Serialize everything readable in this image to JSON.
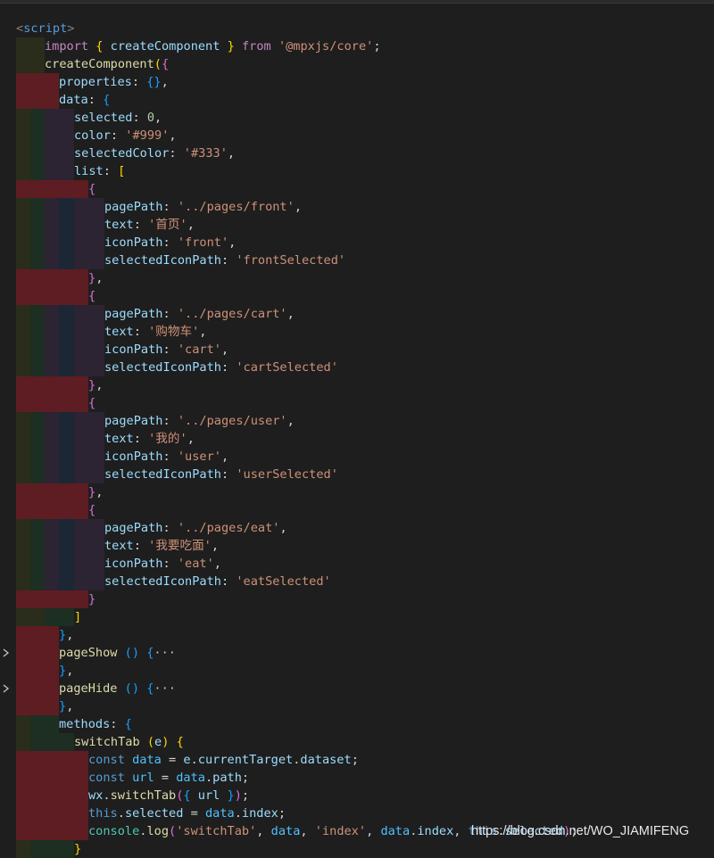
{
  "colors": {
    "background": "#1e1e1e",
    "guide_yellow": "#2a2d1b",
    "guide_green": "#1c2f22",
    "guide_purple": "#2c2333",
    "guide_blue": "#1c2736",
    "guide_error": "#5e1d22"
  },
  "code_lines": [
    {
      "tokens": [
        {
          "t": "<",
          "c": "#808080"
        },
        {
          "t": "script",
          "c": "#569cd6"
        },
        {
          "t": ">",
          "c": "#808080"
        }
      ]
    },
    {
      "tokens": [
        {
          "t": "import",
          "c": "#c586c0"
        },
        {
          "t": " ",
          "c": "#d4d4d4"
        },
        {
          "t": "{",
          "c": "#ffd700"
        },
        {
          "t": " createComponent ",
          "c": "#9cdcfe"
        },
        {
          "t": "}",
          "c": "#ffd700"
        },
        {
          "t": " ",
          "c": "#d4d4d4"
        },
        {
          "t": "from",
          "c": "#c586c0"
        },
        {
          "t": " ",
          "c": "#d4d4d4"
        },
        {
          "t": "'@mpxjs/core'",
          "c": "#ce9178"
        },
        {
          "t": ";",
          "c": "#d4d4d4"
        }
      ]
    },
    {
      "tokens": [
        {
          "t": "createComponent",
          "c": "#dcdcaa"
        },
        {
          "t": "(",
          "c": "#ffd700"
        },
        {
          "t": "{",
          "c": "#da70d6"
        }
      ]
    },
    {
      "tokens": [
        {
          "t": "properties",
          "c": "#9cdcfe"
        },
        {
          "t": ": ",
          "c": "#d4d4d4"
        },
        {
          "t": "{}",
          "c": "#179fff"
        },
        {
          "t": ",",
          "c": "#d4d4d4"
        }
      ]
    },
    {
      "tokens": [
        {
          "t": "data",
          "c": "#9cdcfe"
        },
        {
          "t": ": ",
          "c": "#d4d4d4"
        },
        {
          "t": "{",
          "c": "#179fff"
        }
      ]
    },
    {
      "tokens": [
        {
          "t": "selected",
          "c": "#9cdcfe"
        },
        {
          "t": ": ",
          "c": "#d4d4d4"
        },
        {
          "t": "0",
          "c": "#b5cea8"
        },
        {
          "t": ",",
          "c": "#d4d4d4"
        }
      ]
    },
    {
      "tokens": [
        {
          "t": "color",
          "c": "#9cdcfe"
        },
        {
          "t": ": ",
          "c": "#d4d4d4"
        },
        {
          "t": "'#999'",
          "c": "#ce9178"
        },
        {
          "t": ",",
          "c": "#d4d4d4"
        }
      ]
    },
    {
      "tokens": [
        {
          "t": "selectedColor",
          "c": "#9cdcfe"
        },
        {
          "t": ": ",
          "c": "#d4d4d4"
        },
        {
          "t": "'#333'",
          "c": "#ce9178"
        },
        {
          "t": ",",
          "c": "#d4d4d4"
        }
      ]
    },
    {
      "tokens": [
        {
          "t": "list",
          "c": "#9cdcfe"
        },
        {
          "t": ": ",
          "c": "#d4d4d4"
        },
        {
          "t": "[",
          "c": "#ffd700"
        }
      ]
    },
    {
      "tokens": [
        {
          "t": "{",
          "c": "#da70d6"
        }
      ]
    },
    {
      "tokens": [
        {
          "t": "pagePath",
          "c": "#9cdcfe"
        },
        {
          "t": ": ",
          "c": "#d4d4d4"
        },
        {
          "t": "'../pages/front'",
          "c": "#ce9178"
        },
        {
          "t": ",",
          "c": "#d4d4d4"
        }
      ]
    },
    {
      "tokens": [
        {
          "t": "text",
          "c": "#9cdcfe"
        },
        {
          "t": ": ",
          "c": "#d4d4d4"
        },
        {
          "t": "'首页'",
          "c": "#ce9178"
        },
        {
          "t": ",",
          "c": "#d4d4d4"
        }
      ]
    },
    {
      "tokens": [
        {
          "t": "iconPath",
          "c": "#9cdcfe"
        },
        {
          "t": ": ",
          "c": "#d4d4d4"
        },
        {
          "t": "'front'",
          "c": "#ce9178"
        },
        {
          "t": ",",
          "c": "#d4d4d4"
        }
      ]
    },
    {
      "tokens": [
        {
          "t": "selectedIconPath",
          "c": "#9cdcfe"
        },
        {
          "t": ": ",
          "c": "#d4d4d4"
        },
        {
          "t": "'frontSelected'",
          "c": "#ce9178"
        }
      ]
    },
    {
      "tokens": [
        {
          "t": "}",
          "c": "#da70d6"
        },
        {
          "t": ",",
          "c": "#d4d4d4"
        }
      ]
    },
    {
      "tokens": [
        {
          "t": "{",
          "c": "#da70d6"
        }
      ]
    },
    {
      "tokens": [
        {
          "t": "pagePath",
          "c": "#9cdcfe"
        },
        {
          "t": ": ",
          "c": "#d4d4d4"
        },
        {
          "t": "'../pages/cart'",
          "c": "#ce9178"
        },
        {
          "t": ",",
          "c": "#d4d4d4"
        }
      ]
    },
    {
      "tokens": [
        {
          "t": "text",
          "c": "#9cdcfe"
        },
        {
          "t": ": ",
          "c": "#d4d4d4"
        },
        {
          "t": "'购物车'",
          "c": "#ce9178"
        },
        {
          "t": ",",
          "c": "#d4d4d4"
        }
      ]
    },
    {
      "tokens": [
        {
          "t": "iconPath",
          "c": "#9cdcfe"
        },
        {
          "t": ": ",
          "c": "#d4d4d4"
        },
        {
          "t": "'cart'",
          "c": "#ce9178"
        },
        {
          "t": ",",
          "c": "#d4d4d4"
        }
      ]
    },
    {
      "tokens": [
        {
          "t": "selectedIconPath",
          "c": "#9cdcfe"
        },
        {
          "t": ": ",
          "c": "#d4d4d4"
        },
        {
          "t": "'cartSelected'",
          "c": "#ce9178"
        }
      ]
    },
    {
      "tokens": [
        {
          "t": "}",
          "c": "#da70d6"
        },
        {
          "t": ",",
          "c": "#d4d4d4"
        }
      ]
    },
    {
      "tokens": [
        {
          "t": "{",
          "c": "#da70d6"
        }
      ]
    },
    {
      "tokens": [
        {
          "t": "pagePath",
          "c": "#9cdcfe"
        },
        {
          "t": ": ",
          "c": "#d4d4d4"
        },
        {
          "t": "'../pages/user'",
          "c": "#ce9178"
        },
        {
          "t": ",",
          "c": "#d4d4d4"
        }
      ]
    },
    {
      "tokens": [
        {
          "t": "text",
          "c": "#9cdcfe"
        },
        {
          "t": ": ",
          "c": "#d4d4d4"
        },
        {
          "t": "'我的'",
          "c": "#ce9178"
        },
        {
          "t": ",",
          "c": "#d4d4d4"
        }
      ]
    },
    {
      "tokens": [
        {
          "t": "iconPath",
          "c": "#9cdcfe"
        },
        {
          "t": ": ",
          "c": "#d4d4d4"
        },
        {
          "t": "'user'",
          "c": "#ce9178"
        },
        {
          "t": ",",
          "c": "#d4d4d4"
        }
      ]
    },
    {
      "tokens": [
        {
          "t": "selectedIconPath",
          "c": "#9cdcfe"
        },
        {
          "t": ": ",
          "c": "#d4d4d4"
        },
        {
          "t": "'userSelected'",
          "c": "#ce9178"
        }
      ]
    },
    {
      "tokens": [
        {
          "t": "}",
          "c": "#da70d6"
        },
        {
          "t": ",",
          "c": "#d4d4d4"
        }
      ]
    },
    {
      "tokens": [
        {
          "t": "{",
          "c": "#da70d6"
        }
      ]
    },
    {
      "tokens": [
        {
          "t": "pagePath",
          "c": "#9cdcfe"
        },
        {
          "t": ": ",
          "c": "#d4d4d4"
        },
        {
          "t": "'../pages/eat'",
          "c": "#ce9178"
        },
        {
          "t": ",",
          "c": "#d4d4d4"
        }
      ]
    },
    {
      "tokens": [
        {
          "t": "text",
          "c": "#9cdcfe"
        },
        {
          "t": ": ",
          "c": "#d4d4d4"
        },
        {
          "t": "'我要吃面'",
          "c": "#ce9178"
        },
        {
          "t": ",",
          "c": "#d4d4d4"
        }
      ]
    },
    {
      "tokens": [
        {
          "t": "iconPath",
          "c": "#9cdcfe"
        },
        {
          "t": ": ",
          "c": "#d4d4d4"
        },
        {
          "t": "'eat'",
          "c": "#ce9178"
        },
        {
          "t": ",",
          "c": "#d4d4d4"
        }
      ]
    },
    {
      "tokens": [
        {
          "t": "selectedIconPath",
          "c": "#9cdcfe"
        },
        {
          "t": ": ",
          "c": "#d4d4d4"
        },
        {
          "t": "'eatSelected'",
          "c": "#ce9178"
        }
      ]
    },
    {
      "tokens": [
        {
          "t": "}",
          "c": "#da70d6"
        }
      ]
    },
    {
      "tokens": [
        {
          "t": "]",
          "c": "#ffd700"
        }
      ]
    },
    {
      "tokens": [
        {
          "t": "}",
          "c": "#179fff"
        },
        {
          "t": ",",
          "c": "#d4d4d4"
        }
      ]
    },
    {
      "fold": true,
      "tokens": [
        {
          "t": "pageShow",
          "c": "#dcdcaa"
        },
        {
          "t": " ",
          "c": "#d4d4d4"
        },
        {
          "t": "()",
          "c": "#179fff"
        },
        {
          "t": " ",
          "c": "#d4d4d4"
        },
        {
          "t": "{",
          "c": "#179fff"
        },
        {
          "t": "···",
          "c": "#c5c5c5"
        }
      ]
    },
    {
      "tokens": [
        {
          "t": "}",
          "c": "#179fff"
        },
        {
          "t": ",",
          "c": "#d4d4d4"
        }
      ]
    },
    {
      "fold": true,
      "tokens": [
        {
          "t": "pageHide",
          "c": "#dcdcaa"
        },
        {
          "t": " ",
          "c": "#d4d4d4"
        },
        {
          "t": "()",
          "c": "#179fff"
        },
        {
          "t": " ",
          "c": "#d4d4d4"
        },
        {
          "t": "{",
          "c": "#179fff"
        },
        {
          "t": "···",
          "c": "#c5c5c5"
        }
      ]
    },
    {
      "tokens": [
        {
          "t": "}",
          "c": "#179fff"
        },
        {
          "t": ",",
          "c": "#d4d4d4"
        }
      ]
    },
    {
      "tokens": [
        {
          "t": "methods",
          "c": "#9cdcfe"
        },
        {
          "t": ": ",
          "c": "#d4d4d4"
        },
        {
          "t": "{",
          "c": "#179fff"
        }
      ]
    },
    {
      "tokens": [
        {
          "t": "switchTab",
          "c": "#dcdcaa"
        },
        {
          "t": " ",
          "c": "#d4d4d4"
        },
        {
          "t": "(",
          "c": "#ffd700"
        },
        {
          "t": "e",
          "c": "#9cdcfe"
        },
        {
          "t": ")",
          "c": "#ffd700"
        },
        {
          "t": " ",
          "c": "#d4d4d4"
        },
        {
          "t": "{",
          "c": "#ffd700"
        }
      ]
    },
    {
      "tokens": [
        {
          "t": "const",
          "c": "#569cd6"
        },
        {
          "t": " ",
          "c": "#d4d4d4"
        },
        {
          "t": "data",
          "c": "#4fc1ff"
        },
        {
          "t": " = ",
          "c": "#d4d4d4"
        },
        {
          "t": "e",
          "c": "#9cdcfe"
        },
        {
          "t": ".",
          "c": "#d4d4d4"
        },
        {
          "t": "currentTarget",
          "c": "#9cdcfe"
        },
        {
          "t": ".",
          "c": "#d4d4d4"
        },
        {
          "t": "dataset",
          "c": "#9cdcfe"
        },
        {
          "t": ";",
          "c": "#d4d4d4"
        }
      ]
    },
    {
      "tokens": [
        {
          "t": "const",
          "c": "#569cd6"
        },
        {
          "t": " ",
          "c": "#d4d4d4"
        },
        {
          "t": "url",
          "c": "#4fc1ff"
        },
        {
          "t": " = ",
          "c": "#d4d4d4"
        },
        {
          "t": "data",
          "c": "#4fc1ff"
        },
        {
          "t": ".",
          "c": "#d4d4d4"
        },
        {
          "t": "path",
          "c": "#9cdcfe"
        },
        {
          "t": ";",
          "c": "#d4d4d4"
        }
      ]
    },
    {
      "tokens": [
        {
          "t": "wx",
          "c": "#9cdcfe"
        },
        {
          "t": ".",
          "c": "#d4d4d4"
        },
        {
          "t": "switchTab",
          "c": "#dcdcaa"
        },
        {
          "t": "(",
          "c": "#da70d6"
        },
        {
          "t": "{",
          "c": "#179fff"
        },
        {
          "t": " url ",
          "c": "#9cdcfe"
        },
        {
          "t": "}",
          "c": "#179fff"
        },
        {
          "t": ")",
          "c": "#da70d6"
        },
        {
          "t": ";",
          "c": "#d4d4d4"
        }
      ]
    },
    {
      "tokens": [
        {
          "t": "this",
          "c": "#569cd6"
        },
        {
          "t": ".",
          "c": "#d4d4d4"
        },
        {
          "t": "selected",
          "c": "#9cdcfe"
        },
        {
          "t": " = ",
          "c": "#d4d4d4"
        },
        {
          "t": "data",
          "c": "#4fc1ff"
        },
        {
          "t": ".",
          "c": "#d4d4d4"
        },
        {
          "t": "index",
          "c": "#9cdcfe"
        },
        {
          "t": ";",
          "c": "#d4d4d4"
        }
      ]
    },
    {
      "tokens": [
        {
          "t": "console",
          "c": "#4ec9b0"
        },
        {
          "t": ".",
          "c": "#d4d4d4"
        },
        {
          "t": "log",
          "c": "#dcdcaa"
        },
        {
          "t": "(",
          "c": "#da70d6"
        },
        {
          "t": "'switchTab'",
          "c": "#ce9178"
        },
        {
          "t": ", ",
          "c": "#d4d4d4"
        },
        {
          "t": "data",
          "c": "#4fc1ff"
        },
        {
          "t": ", ",
          "c": "#d4d4d4"
        },
        {
          "t": "'index'",
          "c": "#ce9178"
        },
        {
          "t": ", ",
          "c": "#d4d4d4"
        },
        {
          "t": "data",
          "c": "#4fc1ff"
        },
        {
          "t": ".",
          "c": "#d4d4d4"
        },
        {
          "t": "index",
          "c": "#9cdcfe"
        },
        {
          "t": ", ",
          "c": "#d4d4d4"
        },
        {
          "t": "this",
          "c": "#569cd6"
        },
        {
          "t": ".",
          "c": "#d4d4d4"
        },
        {
          "t": "selected",
          "c": "#9cdcfe"
        },
        {
          "t": ")",
          "c": "#da70d6"
        },
        {
          "t": ";",
          "c": "#d4d4d4"
        }
      ]
    },
    {
      "tokens": [
        {
          "t": "}",
          "c": "#ffd700"
        }
      ]
    }
  ],
  "watermark": "https://blog.csdn.net/WO_JIAMIFENG"
}
